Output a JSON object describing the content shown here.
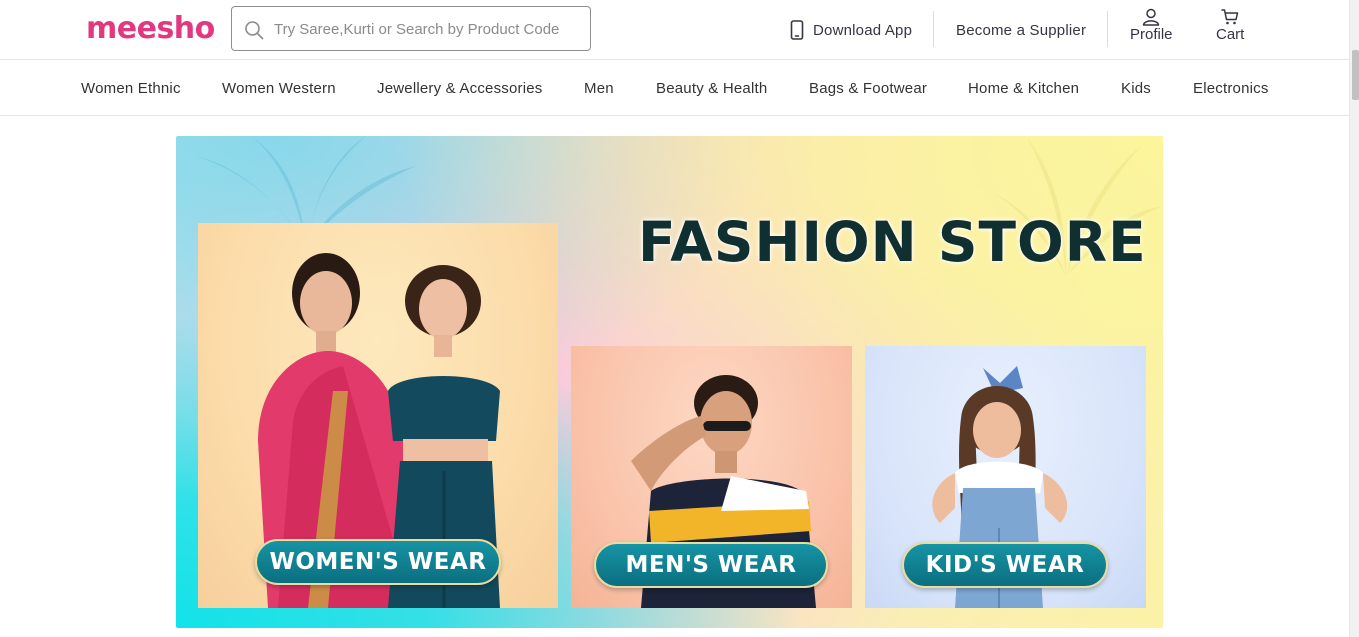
{
  "header": {
    "logo": "meesho",
    "search_placeholder": "Try Saree,Kurti or Search by Product Code",
    "search_icon": "search-icon",
    "download_app": "Download App",
    "become_supplier": "Become a Supplier",
    "profile": "Profile",
    "cart": "Cart",
    "brand_color": "#e2387f"
  },
  "categories": [
    "Women Ethnic",
    "Women Western",
    "Jewellery & Accessories",
    "Men",
    "Beauty & Health",
    "Bags & Footwear",
    "Home & Kitchen",
    "Kids",
    "Electronics"
  ],
  "banner": {
    "title": "FASHION STORE",
    "cards": {
      "women": "WOMEN'S WEAR",
      "men": "MEN'S WEAR",
      "kids": "KID'S WEAR"
    },
    "pill_color": "#0f7d8d"
  }
}
